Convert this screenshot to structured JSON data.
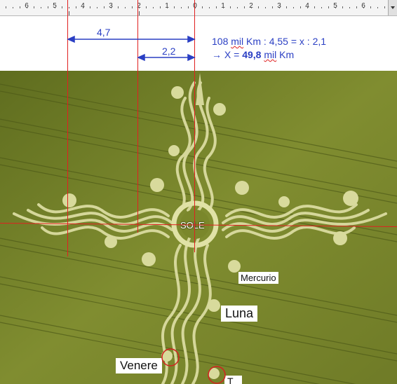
{
  "ruler": {
    "numbers": [
      "6",
      "5",
      "4",
      "3",
      "2",
      "1",
      "0",
      "1",
      "2",
      "3",
      "4",
      "5",
      "6"
    ]
  },
  "measurements": {
    "dimension_a": "4,7",
    "dimension_b": "2,2"
  },
  "formula": {
    "line1_prefix": "108 ",
    "line1_word1": "mil",
    "line1_suffix": " Km :  4,55 =  x : 2,1",
    "arrow": "→ X = ",
    "result": "49,8",
    "line2_space": " ",
    "line2_word": "mil",
    "line2_unit": " Km"
  },
  "labels": {
    "center": "SOLE",
    "mercurio": "Mercurio",
    "luna": "Luna",
    "venere": "Venere",
    "bottom_partial": "T"
  },
  "colors": {
    "guide_line": "#e02020",
    "dimension_blue": "#2a3fc4",
    "field_green": "#7f8d2e"
  }
}
